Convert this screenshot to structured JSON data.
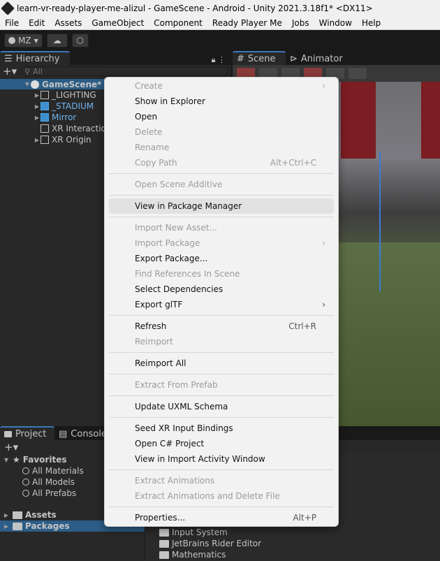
{
  "window": {
    "title": "learn-vr-ready-player-me-alizul - GameScene - Android - Unity 2021.3.18f1* <DX11>"
  },
  "menubar": [
    "File",
    "Edit",
    "Assets",
    "GameObject",
    "Component",
    "Ready Player Me",
    "Jobs",
    "Window",
    "Help"
  ],
  "toolbar": {
    "account": "MZ"
  },
  "hierarchy": {
    "tab": "Hierarchy",
    "search_placeholder": "All",
    "scene": "GameScene*",
    "items": [
      "_LIGHTING",
      "_STADIUM",
      "Mirror",
      "XR Interaction",
      "XR Origin"
    ]
  },
  "scene_tabs": {
    "scene": "Scene",
    "animator": "Animator"
  },
  "project": {
    "tab_project": "Project",
    "tab_console": "Console",
    "favorites": "Favorites",
    "fav_items": [
      "All Materials",
      "All Models",
      "All Prefabs"
    ],
    "assets": "Assets",
    "packages": "Packages",
    "right_items": [
      "Input System",
      "JetBrains Rider Editor",
      "Mathematics"
    ]
  },
  "context_menu": {
    "create": "Create",
    "show_explorer": "Show in Explorer",
    "open": "Open",
    "delete": "Delete",
    "rename": "Rename",
    "copy_path": "Copy Path",
    "copy_path_sc": "Alt+Ctrl+C",
    "open_scene_additive": "Open Scene Additive",
    "view_package_manager": "View in Package Manager",
    "import_new_asset": "Import New Asset...",
    "import_package": "Import Package",
    "export_package": "Export Package...",
    "find_references": "Find References In Scene",
    "select_dependencies": "Select Dependencies",
    "export_gltf": "Export glTF",
    "refresh": "Refresh",
    "refresh_sc": "Ctrl+R",
    "reimport": "Reimport",
    "reimport_all": "Reimport All",
    "extract_prefab": "Extract From Prefab",
    "update_uxml": "Update UXML Schema",
    "seed_xr": "Seed XR Input Bindings",
    "open_csharp": "Open C# Project",
    "view_import_activity": "View in Import Activity Window",
    "extract_animations": "Extract Animations",
    "extract_animations_delete": "Extract Animations and Delete File",
    "properties": "Properties...",
    "properties_sc": "Alt+P"
  }
}
